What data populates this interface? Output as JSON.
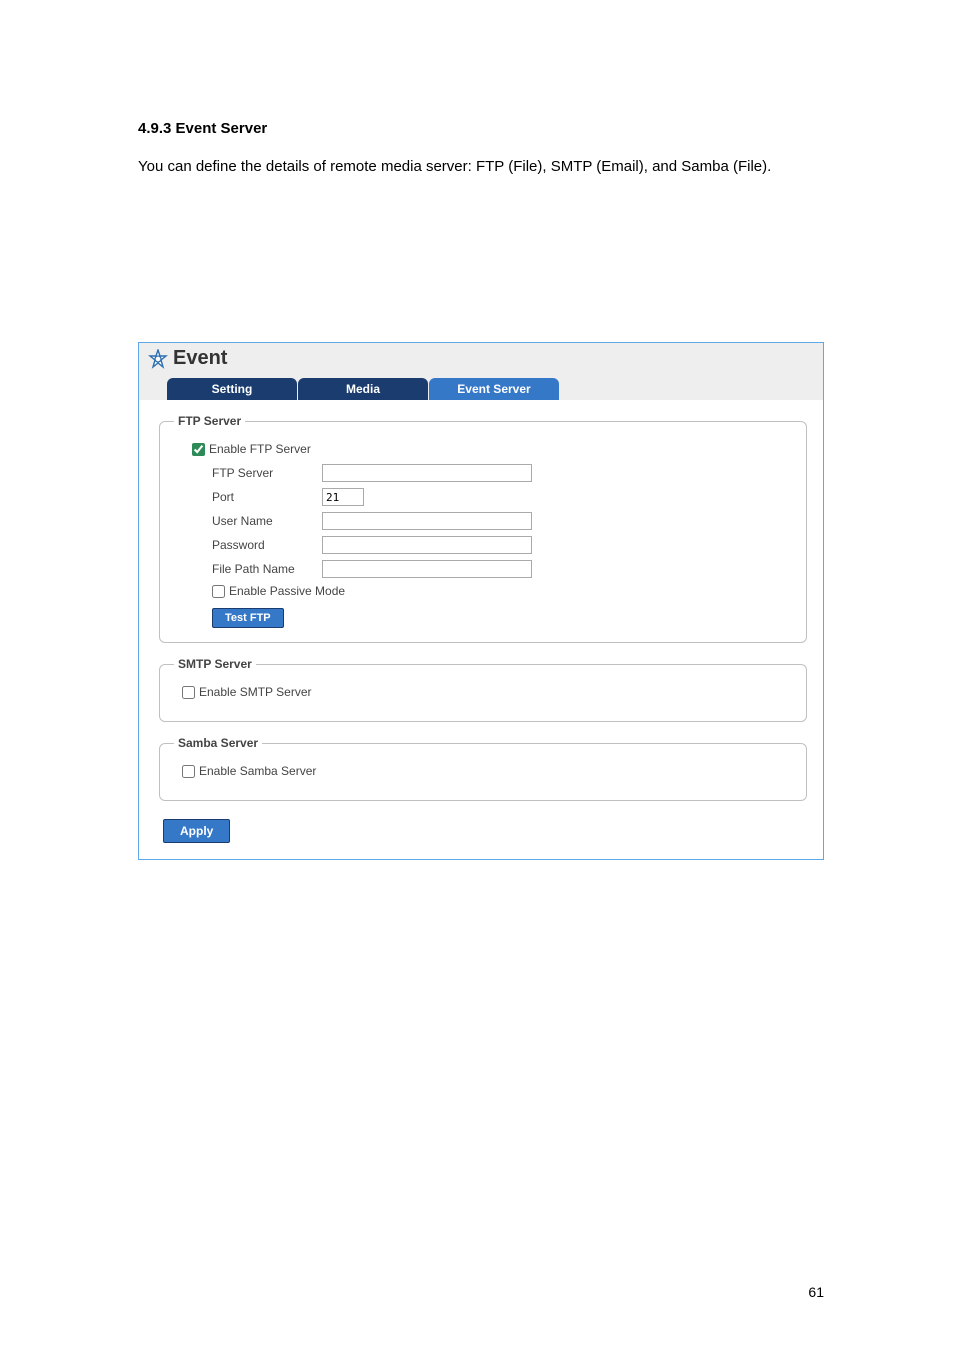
{
  "doc": {
    "heading": "4.9.3 Event Server",
    "body": "You can define the details of remote media server: FTP (File), SMTP (Email), and Samba (File).",
    "page_num": "61"
  },
  "event": {
    "title": "Event",
    "tabs": {
      "setting": "Setting",
      "media": "Media",
      "event_server": "Event Server"
    },
    "ftp": {
      "legend": "FTP Server",
      "enable_label": "Enable FTP Server",
      "server_label": "FTP Server",
      "server_value": "",
      "port_label": "Port",
      "port_value": "21",
      "user_label": "User Name",
      "user_value": "",
      "pass_label": "Password",
      "pass_value": "",
      "path_label": "File Path Name",
      "path_value": "",
      "passive_label": "Enable Passive Mode",
      "test_btn": "Test FTP"
    },
    "smtp": {
      "legend": "SMTP Server",
      "enable_label": "Enable SMTP Server"
    },
    "samba": {
      "legend": "Samba Server",
      "enable_label": "Enable Samba Server"
    },
    "apply": "Apply"
  }
}
